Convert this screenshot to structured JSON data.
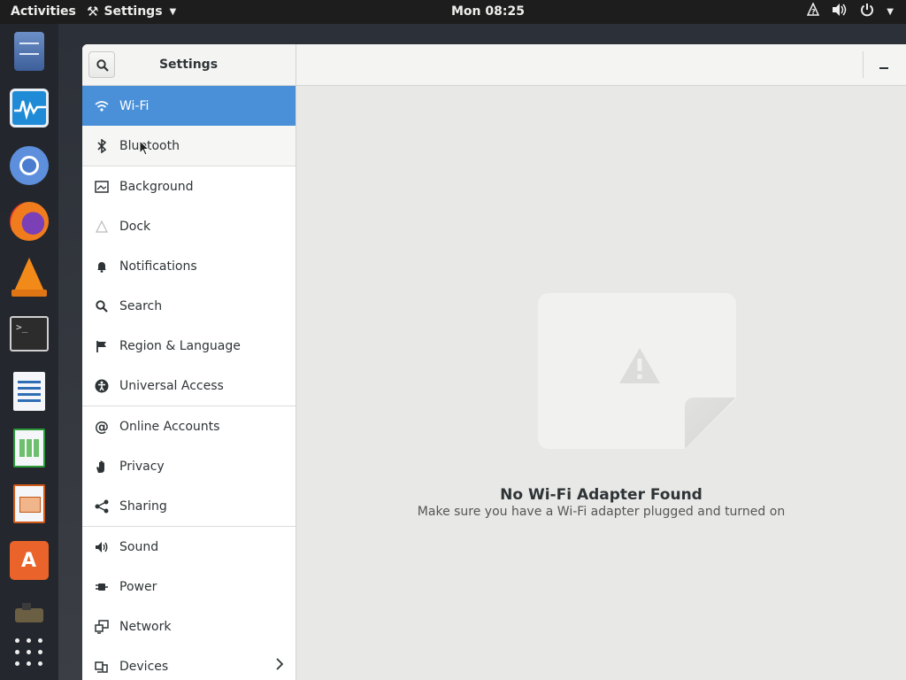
{
  "top_panel": {
    "activities": "Activities",
    "app_name": "Settings",
    "clock": "Mon 08:25"
  },
  "dock": {
    "apps": [
      "Files",
      "System Monitor",
      "Chromium",
      "Firefox",
      "VLC",
      "Terminal",
      "LibreOffice Writer",
      "LibreOffice Calc",
      "LibreOffice Impress",
      "Ubuntu Software",
      "Misc",
      "Show Applications"
    ],
    "terminal_prompt": ">_"
  },
  "sidebar": {
    "title": "Settings",
    "items": [
      {
        "label": "Wi-Fi",
        "icon": "wifi-icon"
      },
      {
        "label": "Bluetooth",
        "icon": "bluetooth-icon"
      },
      {
        "label": "Background",
        "icon": "background-icon"
      },
      {
        "label": "Dock",
        "icon": "dock-icon"
      },
      {
        "label": "Notifications",
        "icon": "bell-icon"
      },
      {
        "label": "Search",
        "icon": "search-icon"
      },
      {
        "label": "Region & Language",
        "icon": "flag-icon"
      },
      {
        "label": "Universal Access",
        "icon": "accessibility-icon"
      },
      {
        "label": "Online Accounts",
        "icon": "at-icon"
      },
      {
        "label": "Privacy",
        "icon": "hand-icon"
      },
      {
        "label": "Sharing",
        "icon": "share-icon"
      },
      {
        "label": "Sound",
        "icon": "speaker-icon"
      },
      {
        "label": "Power",
        "icon": "power-plug-icon"
      },
      {
        "label": "Network",
        "icon": "network-icon"
      },
      {
        "label": "Devices",
        "icon": "devices-icon"
      }
    ]
  },
  "content": {
    "empty_title": "No Wi-Fi Adapter Found",
    "empty_subtitle": "Make sure you have a Wi-Fi adapter plugged and turned on"
  },
  "colors": {
    "selected_row": "#4a90d9",
    "top_panel": "#1d1d1d"
  }
}
